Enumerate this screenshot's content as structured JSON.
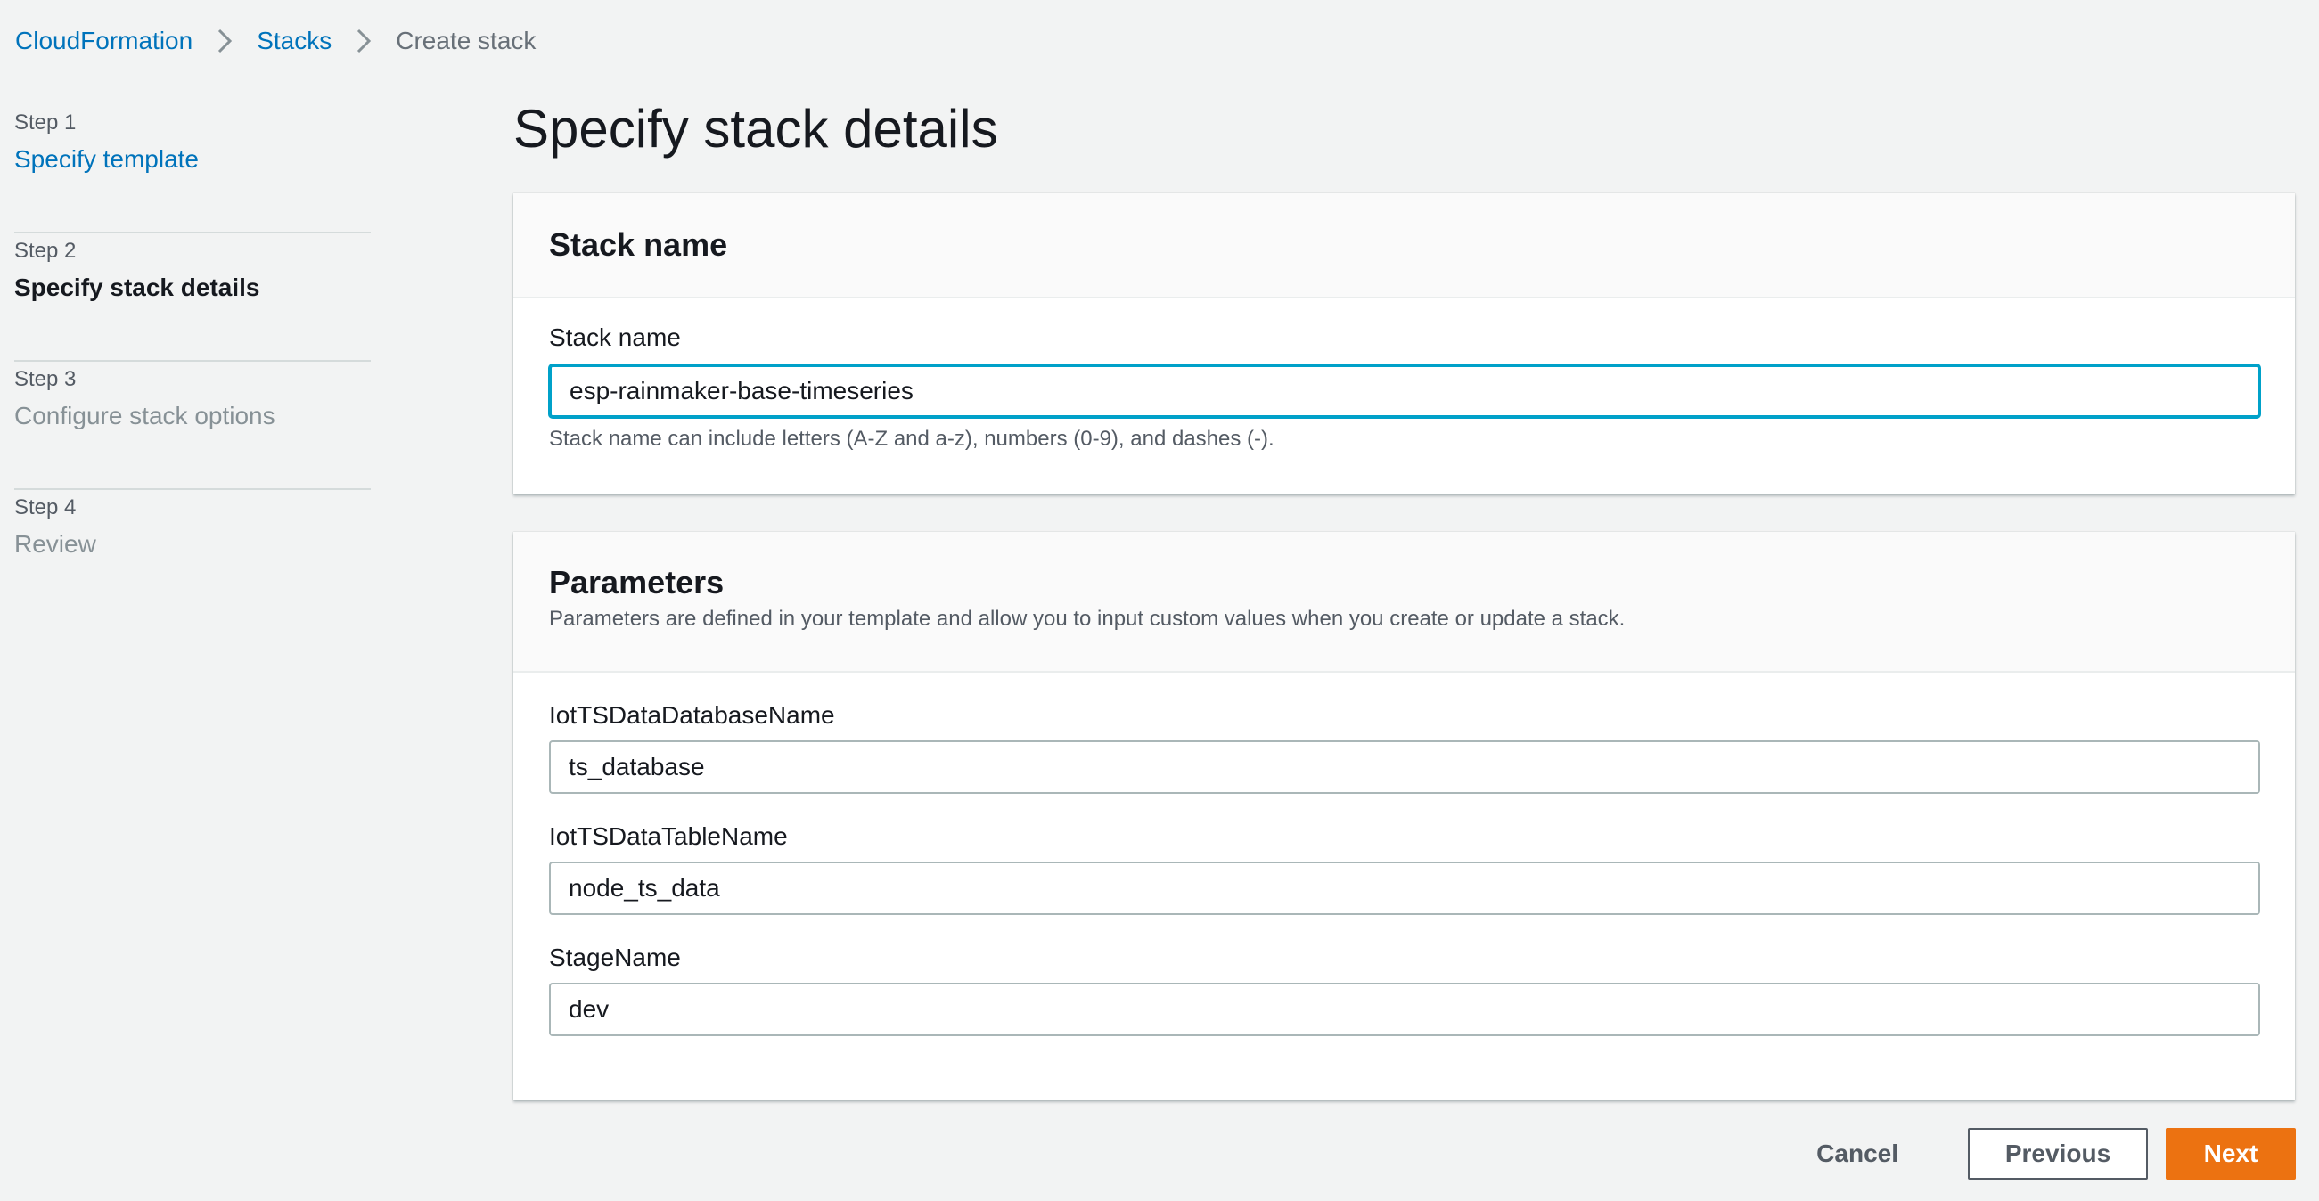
{
  "breadcrumb": {
    "items": [
      "CloudFormation",
      "Stacks",
      "Create stack"
    ]
  },
  "steps": [
    {
      "num": "Step 1",
      "title": "Specify template",
      "state": "link"
    },
    {
      "num": "Step 2",
      "title": "Specify stack details",
      "state": "active"
    },
    {
      "num": "Step 3",
      "title": "Configure stack options",
      "state": "disabled"
    },
    {
      "num": "Step 4",
      "title": "Review",
      "state": "disabled"
    }
  ],
  "page": {
    "title": "Specify stack details"
  },
  "stack_name_panel": {
    "heading": "Stack name",
    "label": "Stack name",
    "value": "esp-rainmaker-base-timeseries",
    "hint": "Stack name can include letters (A-Z and a-z), numbers (0-9), and dashes (-)."
  },
  "parameters_panel": {
    "heading": "Parameters",
    "description": "Parameters are defined in your template and allow you to input custom values when you create or update a stack.",
    "fields": [
      {
        "label": "IotTSDataDatabaseName",
        "value": "ts_database"
      },
      {
        "label": "IotTSDataTableName",
        "value": "node_ts_data"
      },
      {
        "label": "StageName",
        "value": "dev"
      }
    ]
  },
  "footer": {
    "cancel_label": "Cancel",
    "previous_label": "Previous",
    "next_label": "Next"
  },
  "colors": {
    "link": "#0073bb",
    "primary_button": "#ec7211",
    "focus_ring": "#00a1c9",
    "background": "#f2f3f3"
  }
}
